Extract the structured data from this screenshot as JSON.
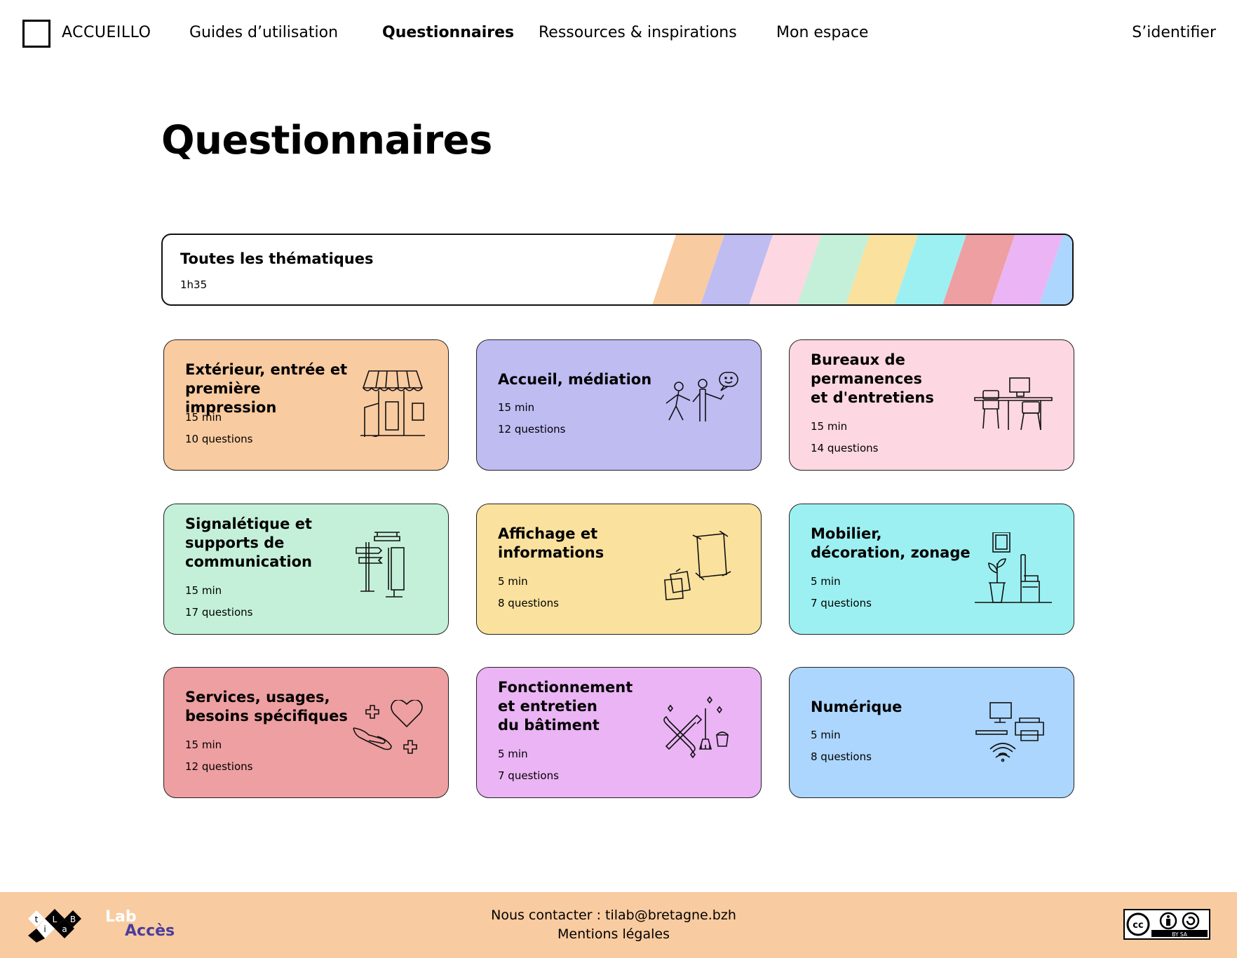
{
  "header": {
    "brand": "ACCUEILLO",
    "nav": [
      {
        "label": "Guides d’utilisation"
      },
      {
        "label": "Questionnaires"
      },
      {
        "label": "Ressources & inspirations"
      },
      {
        "label": "Mon espace"
      }
    ],
    "login": "S’identifier"
  },
  "page_title": "Questionnaires",
  "all_themes": {
    "title": "Toutes les thématiques",
    "duration": "1h35",
    "stripe_colors": [
      "#f9cba0",
      "#bfbcf2",
      "#fdd7e1",
      "#c4f0d9",
      "#fae19e",
      "#9df0f2",
      "#ee9fa1",
      "#ebb4f5",
      "#acd6fd"
    ]
  },
  "cards": [
    {
      "title_lines": [
        "Extérieur, entrée et",
        "première impression"
      ],
      "time": "15 min",
      "count": "10 questions",
      "color": "#f9cba0",
      "icon": "shop-front-icon"
    },
    {
      "title_lines": [
        "Accueil, médiation"
      ],
      "time": "15 min",
      "count": "12 questions",
      "color": "#bfbcf2",
      "icon": "people-talking-icon"
    },
    {
      "title_lines": [
        "Bureaux de",
        "permanences",
        "et d'entretiens"
      ],
      "time": "15 min",
      "count": "14 questions",
      "color": "#fdd7e1",
      "icon": "desk-office-icon"
    },
    {
      "title_lines": [
        "Signalétique et",
        "supports de",
        "communication"
      ],
      "time": "15 min",
      "count": "17 questions",
      "color": "#c4f0d9",
      "icon": "signpost-icon"
    },
    {
      "title_lines": [
        "Affichage et",
        "informations"
      ],
      "time": "5 min",
      "count": "8 questions",
      "color": "#fae19e",
      "icon": "poster-notes-icon"
    },
    {
      "title_lines": [
        "Mobilier,",
        "décoration, zonage"
      ],
      "time": "5 min",
      "count": "7 questions",
      "color": "#9df0f2",
      "icon": "furniture-plant-icon"
    },
    {
      "title_lines": [
        "Services, usages,",
        "besoins spécifiques"
      ],
      "time": "15 min",
      "count": "12 questions",
      "color": "#ee9fa1",
      "icon": "care-heart-icon"
    },
    {
      "title_lines": [
        "Fonctionnement",
        "et entretien",
        "du bâtiment"
      ],
      "time": "5 min",
      "count": "7 questions",
      "color": "#ebb4f5",
      "icon": "tools-cleaning-icon"
    },
    {
      "title_lines": [
        "Numérique"
      ],
      "time": "5 min",
      "count": "8 questions",
      "color": "#acd6fd",
      "icon": "computer-printer-wifi-icon"
    }
  ],
  "footer": {
    "contact": "Nous contacter : tilab@bretagne.bzh",
    "legal": "Mentions légales",
    "partner_lab": "Lab",
    "partner_acces": "Accès",
    "tilab_letters": [
      "t",
      "i",
      "L",
      "a",
      "B"
    ],
    "license": "BY SA"
  }
}
